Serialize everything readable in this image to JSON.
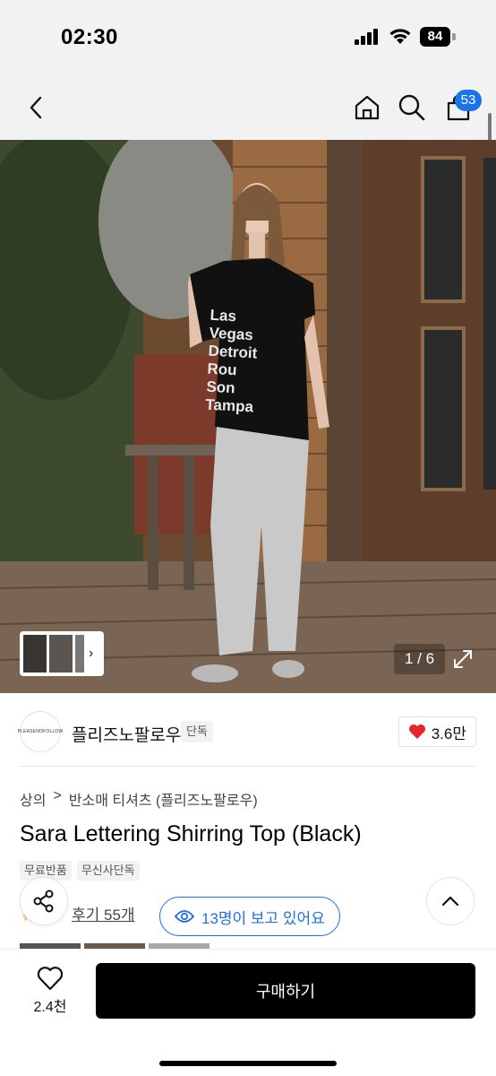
{
  "status_bar": {
    "time": "02:30",
    "battery": "84"
  },
  "nav": {
    "cart_count": "53"
  },
  "gallery": {
    "counter": "1 / 6",
    "shirt_lines": [
      "Las",
      "Vegas",
      "Detroit",
      "Rou",
      "Son",
      "Tampa"
    ]
  },
  "brand": {
    "logo_text": "PLEASENOFOLLOW",
    "name": "플리즈노팔로우",
    "exclusive_tag": "단독",
    "like_count": "3.6만",
    "heart_color": "#e8232b"
  },
  "breadcrumb": {
    "category": "상의",
    "separator": ">",
    "subcategory": "반소매 티셔츠 (플리즈노팔로우)"
  },
  "product": {
    "title": "Sara Lettering Shirring Top (Black)",
    "tags": [
      "무료반품",
      "무신사단독"
    ]
  },
  "review": {
    "link_label": "후기 55개",
    "viewer_text": "13명이 보고 있어요",
    "accent_color": "#1f6fe5"
  },
  "bottom_bar": {
    "wish_count": "2.4천",
    "buy_label": "구매하기"
  }
}
